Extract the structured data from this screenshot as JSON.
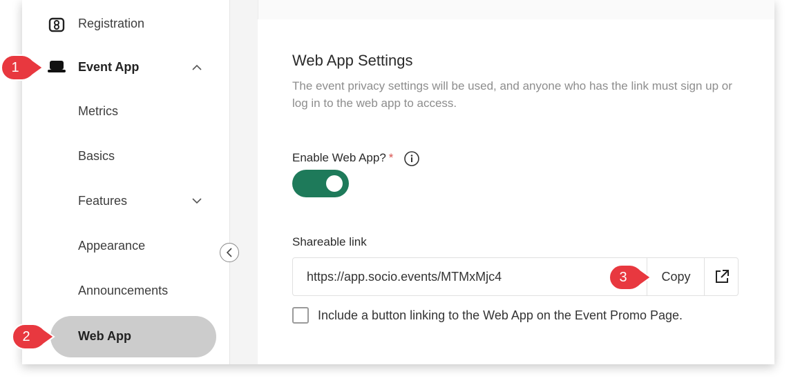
{
  "sidebar": {
    "items": [
      {
        "label": "Registration",
        "icon": "registration-icon"
      },
      {
        "label": "Event App",
        "icon": "laptop-icon",
        "expanded": true
      },
      {
        "label": "Metrics"
      },
      {
        "label": "Basics"
      },
      {
        "label": "Features",
        "expandable": true
      },
      {
        "label": "Appearance"
      },
      {
        "label": "Announcements"
      },
      {
        "label": "Web App",
        "active": true
      }
    ]
  },
  "main": {
    "title": "Web App Settings",
    "description": "The event privacy settings will be used, and anyone who has the link must sign up or log in to the web app to access.",
    "enable_label": "Enable Web App?",
    "required_mark": "*",
    "enable_on": true,
    "link_label": "Shareable link",
    "link_value": "https://app.socio.events/MTMxMjc4",
    "copy_label": "Copy",
    "checkbox_label": "Include a button linking to the Web App on the Event Promo Page.",
    "checkbox_checked": false
  },
  "callouts": [
    "1",
    "2",
    "3"
  ],
  "colors": {
    "toggle_on": "#1e7a5a",
    "active_item_bg": "#cccccc",
    "callout_red": "#e8383f",
    "required": "#d9534f"
  }
}
